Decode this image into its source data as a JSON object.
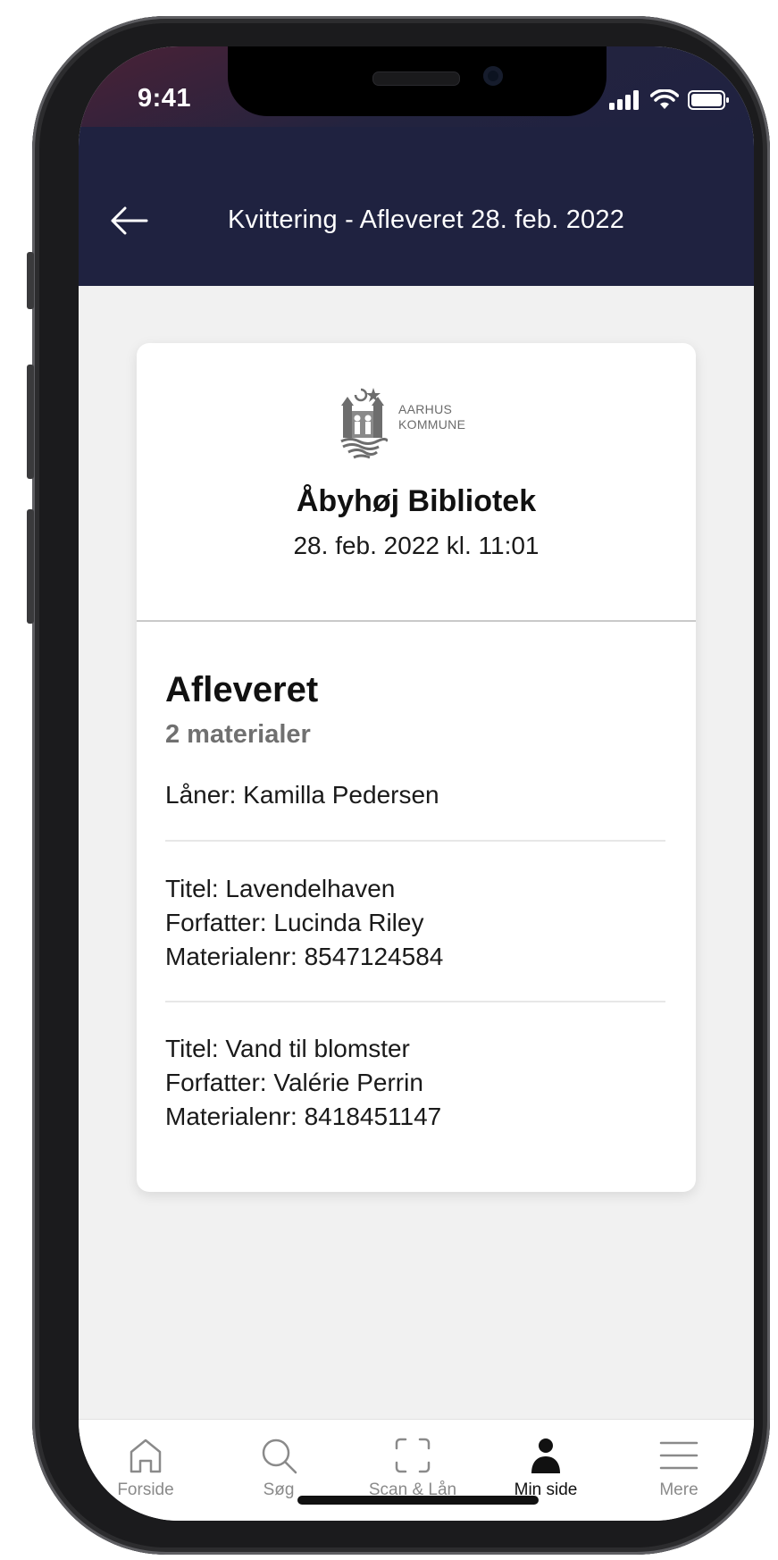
{
  "status_bar": {
    "time": "9:41"
  },
  "header": {
    "title": "Kvittering - Afleveret 28. feb. 2022"
  },
  "receipt": {
    "logo_line1": "AARHUS",
    "logo_line2": "KOMMUNE",
    "library": "Åbyhøj Bibliotek",
    "datetime": "28. feb. 2022 kl. 11:01",
    "section_title": "Afleveret",
    "count": "2 materialer",
    "borrower": "Låner: Kamilla Pedersen",
    "items": [
      {
        "title": "Titel: Lavendelhaven",
        "author": "Forfatter: Lucinda Riley",
        "number": "Materialenr: 8547124584"
      },
      {
        "title": "Titel: Vand til blomster",
        "author": "Forfatter: Valérie Perrin",
        "number": "Materialenr: 8418451147"
      }
    ]
  },
  "tabbar": {
    "tabs": [
      {
        "label": "Forside",
        "icon": "home-icon"
      },
      {
        "label": "Søg",
        "icon": "search-icon"
      },
      {
        "label": "Scan & Lån",
        "icon": "scan-icon"
      },
      {
        "label": "Min side",
        "icon": "person-icon",
        "active": true
      },
      {
        "label": "Mere",
        "icon": "menu-icon"
      }
    ]
  },
  "colors": {
    "header_bg": "#1f2240",
    "page_bg": "#f1f1f1",
    "active_tab": "#111111",
    "inactive_tab": "#8a8a8a"
  }
}
